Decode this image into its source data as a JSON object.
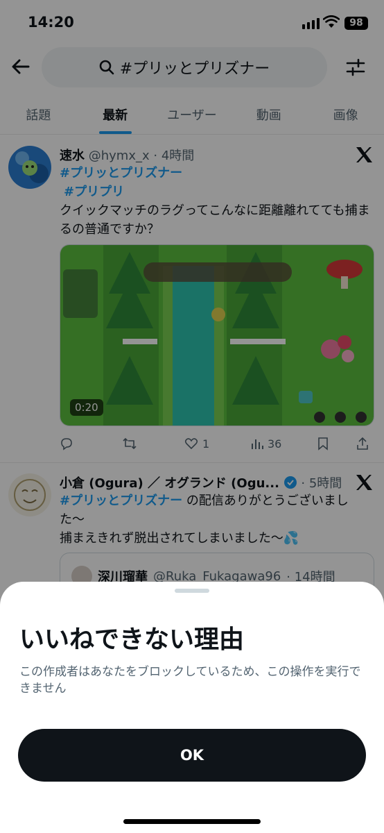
{
  "status": {
    "time": "14:20",
    "battery": "98"
  },
  "search": {
    "query": "#プリッとプリズナー"
  },
  "tabs": [
    {
      "label": "話題"
    },
    {
      "label": "最新"
    },
    {
      "label": "ユーザー"
    },
    {
      "label": "動画"
    },
    {
      "label": "画像"
    }
  ],
  "tweet1": {
    "name": "速水",
    "handle": "@hymx_x",
    "time": "· 4時間",
    "tag1": "#プリッとプリズナー",
    "tag2": "#プリプリ",
    "text": "クイックマッチのラグってこんなに距離離れてても捕まるの普通ですか？",
    "video_duration": "0:20",
    "views": "36",
    "likes": "1"
  },
  "tweet2": {
    "name": "小倉 (Ogura) ／ オグランド (Ogu...",
    "time": "· 5時間",
    "tag": "#プリッとプリズナー",
    "text1": " の配信ありがとうございました〜",
    "text2": "捕まえきれず脱出されてしまいました〜💦",
    "quote_name": "深川瑠華",
    "quote_handle": "@Ruka_Fukagawa96",
    "quote_time": "· 14時間"
  },
  "sheet": {
    "title": "いいねできない理由",
    "description": "この作成者はあなたをブロックしているため、この操作を実行できません",
    "ok_label": "OK"
  },
  "colors": {
    "accent": "#1d9bf0",
    "text": "#0f1419",
    "muted": "#536471"
  }
}
